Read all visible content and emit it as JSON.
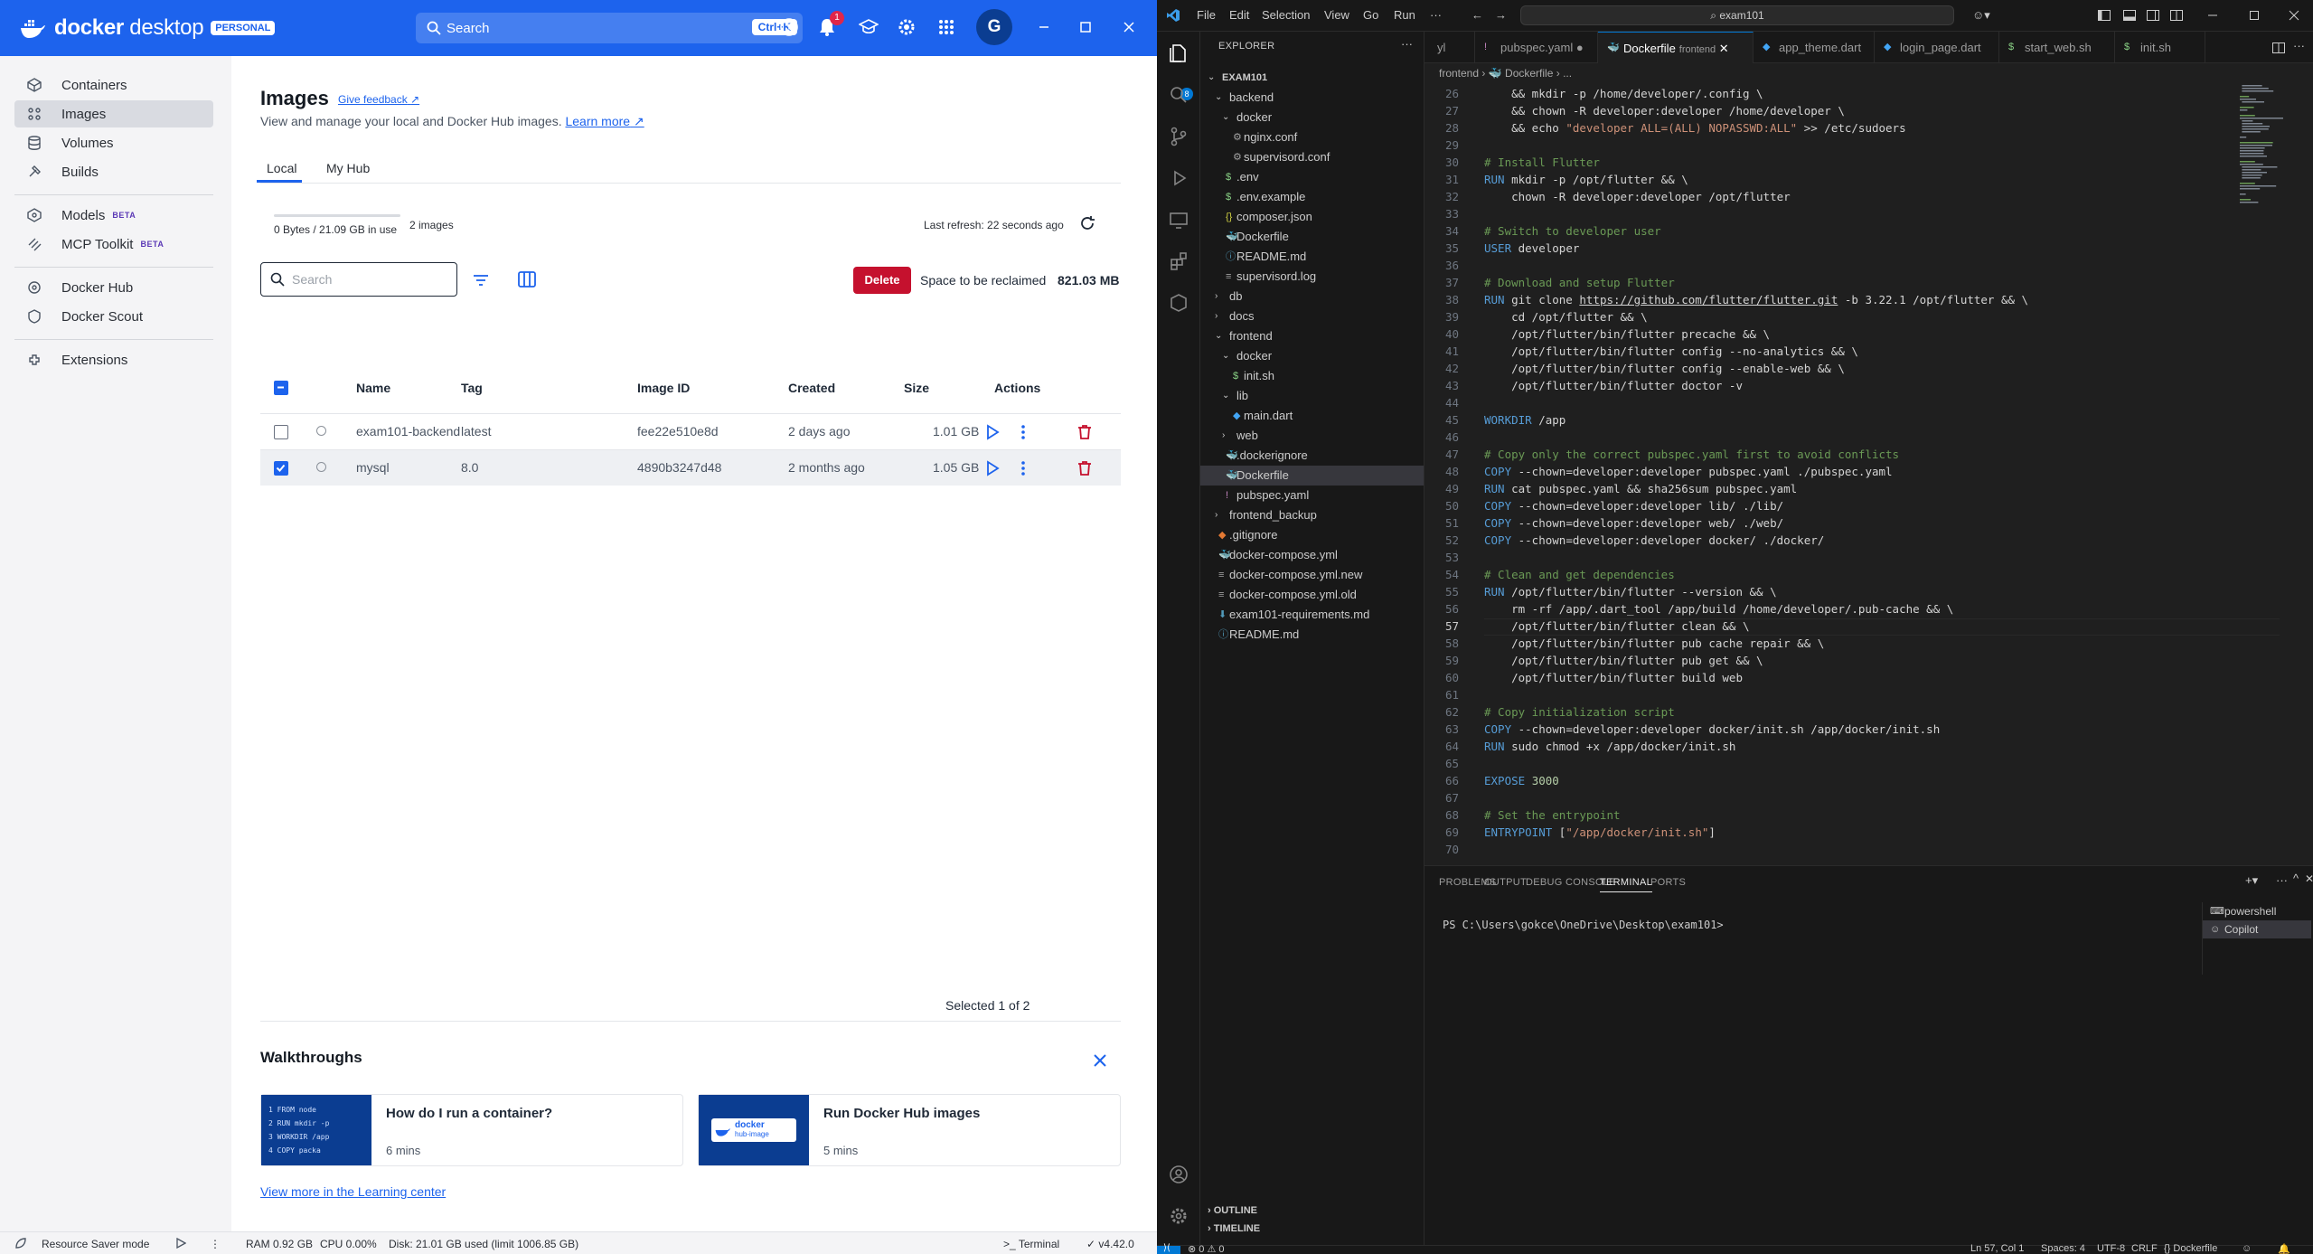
{
  "docker": {
    "brand": "docker",
    "brand_suffix": "desktop",
    "plan_badge": "PERSONAL",
    "search_placeholder": "Search",
    "search_shortcut": "Ctrl+K",
    "notification_count": "1",
    "avatar_initial": "G",
    "sidebar": {
      "items": [
        {
          "label": "Containers",
          "icon": "containers-icon"
        },
        {
          "label": "Images",
          "icon": "images-icon",
          "active": true
        },
        {
          "label": "Volumes",
          "icon": "volumes-icon"
        },
        {
          "label": "Builds",
          "icon": "builds-icon"
        },
        {
          "label": "Models",
          "icon": "models-icon",
          "badge": "BETA"
        },
        {
          "label": "MCP Toolkit",
          "icon": "mcp-toolkit-icon",
          "badge": "BETA"
        },
        {
          "label": "Docker Hub",
          "icon": "docker-hub-icon"
        },
        {
          "label": "Docker Scout",
          "icon": "docker-scout-icon"
        },
        {
          "label": "Extensions",
          "icon": "extensions-icon"
        }
      ]
    },
    "page": {
      "title": "Images",
      "feedback_link": "Give feedback",
      "subtitle": "View and manage your local and Docker Hub images.",
      "learn_more": "Learn more",
      "tabs": [
        "Local",
        "My Hub"
      ],
      "active_tab": "Local",
      "usage_text": "0 Bytes / 21.09 GB in use",
      "usage_fraction": 0.0,
      "images_count": "2 images",
      "last_refresh": "Last refresh: 22 seconds ago",
      "search_placeholder": "Search",
      "delete_label": "Delete",
      "reclaim_label": "Space to be reclaimed",
      "reclaim_value": "821.03 MB",
      "columns": [
        "Name",
        "Tag",
        "Image ID",
        "Created",
        "Size",
        "Actions"
      ],
      "rows": [
        {
          "name": "exam101-backend",
          "tag": "latest",
          "image_id": "fee22e510e8d",
          "created": "2 days ago",
          "size": "1.01 GB",
          "selected": false
        },
        {
          "name": "mysql",
          "tag": "8.0",
          "image_id": "4890b3247d48",
          "created": "2 months ago",
          "size": "1.05 GB",
          "selected": true
        }
      ],
      "selected_count": "Selected 1 of 2"
    },
    "walkthroughs": {
      "title": "Walkthroughs",
      "cards": [
        {
          "title": "How do I run a container?",
          "duration": "6 mins",
          "code": [
            "1  FROM node",
            "2  RUN mkdir -p",
            "3  WORKDIR /app",
            "4  COPY packa"
          ]
        },
        {
          "title": "Run Docker Hub images",
          "duration": "5 mins",
          "thumb_brand": "docker",
          "thumb_sub": "hub-image"
        }
      ],
      "learning_link": "View more in the Learning center"
    },
    "footer": {
      "resource_saver": "Resource Saver mode",
      "ram": "RAM 0.92 GB",
      "cpu": "CPU 0.00%",
      "disk": "Disk: 21.01 GB used (limit 1006.85 GB)",
      "terminal": "Terminal",
      "version": "v4.42.0"
    }
  },
  "vscode": {
    "menu": [
      "File",
      "Edit",
      "Selection",
      "View",
      "Go",
      "Run",
      "···"
    ],
    "command_center": "exam101",
    "explorer_title": "EXPLORER",
    "tree": [
      {
        "name": "EXAM101",
        "depth": 0,
        "type": "root"
      },
      {
        "name": "backend",
        "depth": 1,
        "type": "folder-open"
      },
      {
        "name": "docker",
        "depth": 2,
        "type": "folder-open"
      },
      {
        "name": "nginx.conf",
        "depth": 3,
        "type": "gear"
      },
      {
        "name": "supervisord.conf",
        "depth": 3,
        "type": "gear"
      },
      {
        "name": ".env",
        "depth": 2,
        "type": "dollar"
      },
      {
        "name": ".env.example",
        "depth": 2,
        "type": "dollar"
      },
      {
        "name": "composer.json",
        "depth": 2,
        "type": "braces"
      },
      {
        "name": "Dockerfile",
        "depth": 2,
        "type": "docker"
      },
      {
        "name": "README.md",
        "depth": 2,
        "type": "info"
      },
      {
        "name": "supervisord.log",
        "depth": 2,
        "type": "lines"
      },
      {
        "name": "db",
        "depth": 1,
        "type": "folder"
      },
      {
        "name": "docs",
        "depth": 1,
        "type": "folder"
      },
      {
        "name": "frontend",
        "depth": 1,
        "type": "folder-open"
      },
      {
        "name": "docker",
        "depth": 2,
        "type": "folder-open"
      },
      {
        "name": "init.sh",
        "depth": 3,
        "type": "dollar"
      },
      {
        "name": "lib",
        "depth": 2,
        "type": "folder-open"
      },
      {
        "name": "main.dart",
        "depth": 3,
        "type": "dart"
      },
      {
        "name": "web",
        "depth": 2,
        "type": "folder"
      },
      {
        "name": ".dockerignore",
        "depth": 2,
        "type": "docker"
      },
      {
        "name": "Dockerfile",
        "depth": 2,
        "type": "docker",
        "active": true
      },
      {
        "name": "pubspec.yaml",
        "depth": 2,
        "type": "yaml"
      },
      {
        "name": "frontend_backup",
        "depth": 1,
        "type": "folder"
      },
      {
        "name": ".gitignore",
        "depth": 1,
        "type": "git"
      },
      {
        "name": "docker-compose.yml",
        "depth": 1,
        "type": "compose"
      },
      {
        "name": "docker-compose.yml.new",
        "depth": 1,
        "type": "lines"
      },
      {
        "name": "docker-compose.yml.old",
        "depth": 1,
        "type": "lines"
      },
      {
        "name": "exam101-requirements.md",
        "depth": 1,
        "type": "download"
      },
      {
        "name": "README.md",
        "depth": 1,
        "type": "info"
      }
    ],
    "outline": "OUTLINE",
    "timeline": "TIMELINE",
    "tabs": [
      {
        "label": "yl",
        "icon": ""
      },
      {
        "label": "pubspec.yaml",
        "icon": "!",
        "modified": true
      },
      {
        "label": "Dockerfile",
        "desc": "frontend",
        "icon": "docker",
        "active": true
      },
      {
        "label": "app_theme.dart",
        "icon": "dart"
      },
      {
        "label": "login_page.dart",
        "icon": "dart"
      },
      {
        "label": "start_web.sh",
        "icon": "$"
      },
      {
        "label": "init.sh",
        "icon": "$"
      }
    ],
    "breadcrumbs": [
      "frontend",
      "Dockerfile",
      "..."
    ],
    "code_lines": [
      {
        "n": 26,
        "t": "    && mkdir -p /home/developer/.config \\"
      },
      {
        "n": 27,
        "t": "    && chown -R developer:developer /home/developer \\"
      },
      {
        "n": 28,
        "t": "    && echo \"developer ALL=(ALL) NOPASSWD:ALL\" >> /etc/sudoers"
      },
      {
        "n": 29,
        "t": ""
      },
      {
        "n": 30,
        "t": "# Install Flutter"
      },
      {
        "n": 31,
        "t": "RUN mkdir -p /opt/flutter && \\"
      },
      {
        "n": 32,
        "t": "    chown -R developer:developer /opt/flutter"
      },
      {
        "n": 33,
        "t": ""
      },
      {
        "n": 34,
        "t": "# Switch to developer user"
      },
      {
        "n": 35,
        "t": "USER developer"
      },
      {
        "n": 36,
        "t": ""
      },
      {
        "n": 37,
        "t": "# Download and setup Flutter"
      },
      {
        "n": 38,
        "t": "RUN git clone https://github.com/flutter/flutter.git -b 3.22.1 /opt/flutter && \\"
      },
      {
        "n": 39,
        "t": "    cd /opt/flutter && \\"
      },
      {
        "n": 40,
        "t": "    /opt/flutter/bin/flutter precache && \\"
      },
      {
        "n": 41,
        "t": "    /opt/flutter/bin/flutter config --no-analytics && \\"
      },
      {
        "n": 42,
        "t": "    /opt/flutter/bin/flutter config --enable-web && \\"
      },
      {
        "n": 43,
        "t": "    /opt/flutter/bin/flutter doctor -v"
      },
      {
        "n": 44,
        "t": ""
      },
      {
        "n": 45,
        "t": "WORKDIR /app"
      },
      {
        "n": 46,
        "t": ""
      },
      {
        "n": 47,
        "t": "# Copy only the correct pubspec.yaml first to avoid conflicts"
      },
      {
        "n": 48,
        "t": "COPY --chown=developer:developer pubspec.yaml ./pubspec.yaml"
      },
      {
        "n": 49,
        "t": "RUN cat pubspec.yaml && sha256sum pubspec.yaml"
      },
      {
        "n": 50,
        "t": "COPY --chown=developer:developer lib/ ./lib/"
      },
      {
        "n": 51,
        "t": "COPY --chown=developer:developer web/ ./web/"
      },
      {
        "n": 52,
        "t": "COPY --chown=developer:developer docker/ ./docker/"
      },
      {
        "n": 53,
        "t": ""
      },
      {
        "n": 54,
        "t": "# Clean and get dependencies"
      },
      {
        "n": 55,
        "t": "RUN /opt/flutter/bin/flutter --version && \\"
      },
      {
        "n": 56,
        "t": "    rm -rf /app/.dart_tool /app/build /home/developer/.pub-cache && \\"
      },
      {
        "n": 57,
        "t": "    /opt/flutter/bin/flutter clean && \\"
      },
      {
        "n": 58,
        "t": "    /opt/flutter/bin/flutter pub cache repair && \\"
      },
      {
        "n": 59,
        "t": "    /opt/flutter/bin/flutter pub get && \\"
      },
      {
        "n": 60,
        "t": "    /opt/flutter/bin/flutter build web"
      },
      {
        "n": 61,
        "t": ""
      },
      {
        "n": 62,
        "t": "# Copy initialization script"
      },
      {
        "n": 63,
        "t": "COPY --chown=developer:developer docker/init.sh /app/docker/init.sh"
      },
      {
        "n": 64,
        "t": "RUN sudo chmod +x /app/docker/init.sh"
      },
      {
        "n": 65,
        "t": ""
      },
      {
        "n": 66,
        "t": "EXPOSE 3000"
      },
      {
        "n": 67,
        "t": ""
      },
      {
        "n": 68,
        "t": "# Set the entrypoint"
      },
      {
        "n": 69,
        "t": "ENTRYPOINT [\"/app/docker/init.sh\"]"
      },
      {
        "n": 70,
        "t": ""
      }
    ],
    "current_line": 57,
    "panel": {
      "tabs": [
        "PROBLEMS",
        "OUTPUT",
        "DEBUG CONSOLE",
        "TERMINAL",
        "PORTS"
      ],
      "active_tab": "TERMINAL",
      "prompt": "PS C:\\Users\\gokce\\OneDrive\\Desktop\\exam101>",
      "terminals": [
        "powershell",
        "Copilot"
      ],
      "active_terminal": "Copilot"
    },
    "status": {
      "problems": "⊗ 0 ⚠ 0",
      "position": "Ln 57, Col 1",
      "spaces": "Spaces: 4",
      "encoding": "UTF-8",
      "eol": "CRLF",
      "language": "Dockerfile"
    },
    "colors": {
      "accent": "#0078d4",
      "docker_blue": "#1d63ed"
    }
  }
}
